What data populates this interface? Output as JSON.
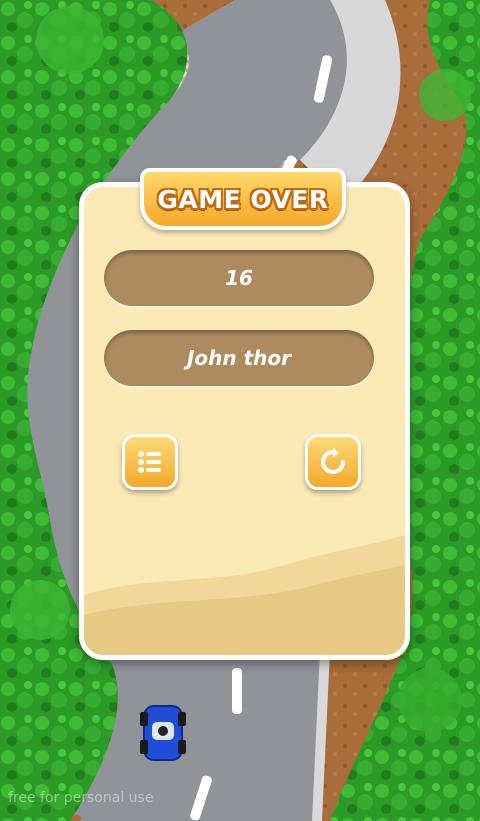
{
  "title": "GAME OVER",
  "score": "16",
  "player_name": "John thor",
  "buttons": {
    "menu_icon": "list-icon",
    "restart_icon": "restart-icon"
  },
  "watermark": "free for personal use",
  "colors": {
    "panel": "#fbe9b6",
    "field": "#ad8b5f",
    "accent": "#f5a92a",
    "grass": "#2f9e2a",
    "road": "#8e9195",
    "dirt": "#a86a3a",
    "car": "#1f4fd8"
  }
}
